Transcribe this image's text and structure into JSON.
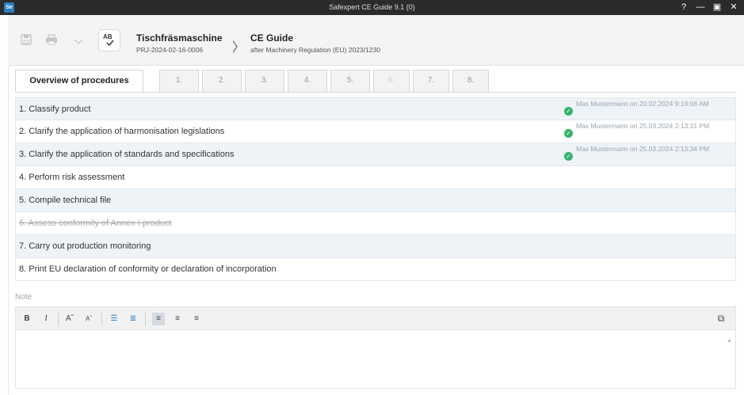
{
  "window": {
    "title": "Safexpert CE Guide 9.1 (0)",
    "app_icon": "Se",
    "controls": {
      "help": "?",
      "minimize": "—",
      "restore": "▣",
      "close": "✕"
    }
  },
  "toolbar": {
    "icons": [
      "save-icon",
      "print-icon",
      "chevron-down-icon",
      "spellcheck-icon"
    ],
    "spellcheck_label": "AB",
    "project_name": "Tischfräsmaschine",
    "project_id": "PRJ-2024-02-16-0006",
    "breadcrumb_arrow": "〉",
    "guide_name": "CE Guide",
    "guide_subtitle": "after Machinery Regulation (EU) 2023/1230"
  },
  "tabs": [
    {
      "label": "Overview of procedures",
      "state": "active"
    },
    {
      "label": "1.",
      "state": "normal"
    },
    {
      "label": "2.",
      "state": "normal"
    },
    {
      "label": "3.",
      "state": "normal"
    },
    {
      "label": "4.",
      "state": "normal"
    },
    {
      "label": "5.",
      "state": "normal"
    },
    {
      "label": "6.",
      "state": "disabled"
    },
    {
      "label": "7.",
      "state": "normal"
    },
    {
      "label": "8.",
      "state": "normal"
    }
  ],
  "procedures": [
    {
      "label": "1. Classify product",
      "status": "Max Mustermann on 20.02.2024 9:19:06 AM",
      "done": true
    },
    {
      "label": "2. Clarify the application of harmonisation legislations",
      "status": "Max Mustermann on 25.03.2024 2:13:31 PM",
      "done": true
    },
    {
      "label": "3. Clarify the application of standards and specifications",
      "status": "Max Mustermann on 25.03.2024 2:13:34 PM",
      "done": true
    },
    {
      "label": "4. Perform risk assessment",
      "status": "",
      "done": false
    },
    {
      "label": "5. Compile technical file",
      "status": "",
      "done": false
    },
    {
      "label": "6. Assess conformity of Annex I product",
      "status": "",
      "done": false,
      "disabled": true
    },
    {
      "label": "7. Carry out production monitoring",
      "status": "",
      "done": false
    },
    {
      "label": "8. Print EU declaration of conformity or declaration of incorporation",
      "status": "",
      "done": false
    }
  ],
  "note": {
    "label": "Note",
    "toolbar": {
      "bold": "B",
      "italic": "I",
      "font_grow": "Aˆ",
      "font_shrink": "Aˇ",
      "bullet_list": "☰",
      "numbered_list": "≣",
      "align_left": "≡",
      "align_center": "≡",
      "align_right": "≡",
      "external": "⧉"
    },
    "content": ""
  },
  "colors": {
    "titlebar": "#2b2b2b",
    "check": "#36b36b",
    "row_shade": "#eef3f8"
  }
}
